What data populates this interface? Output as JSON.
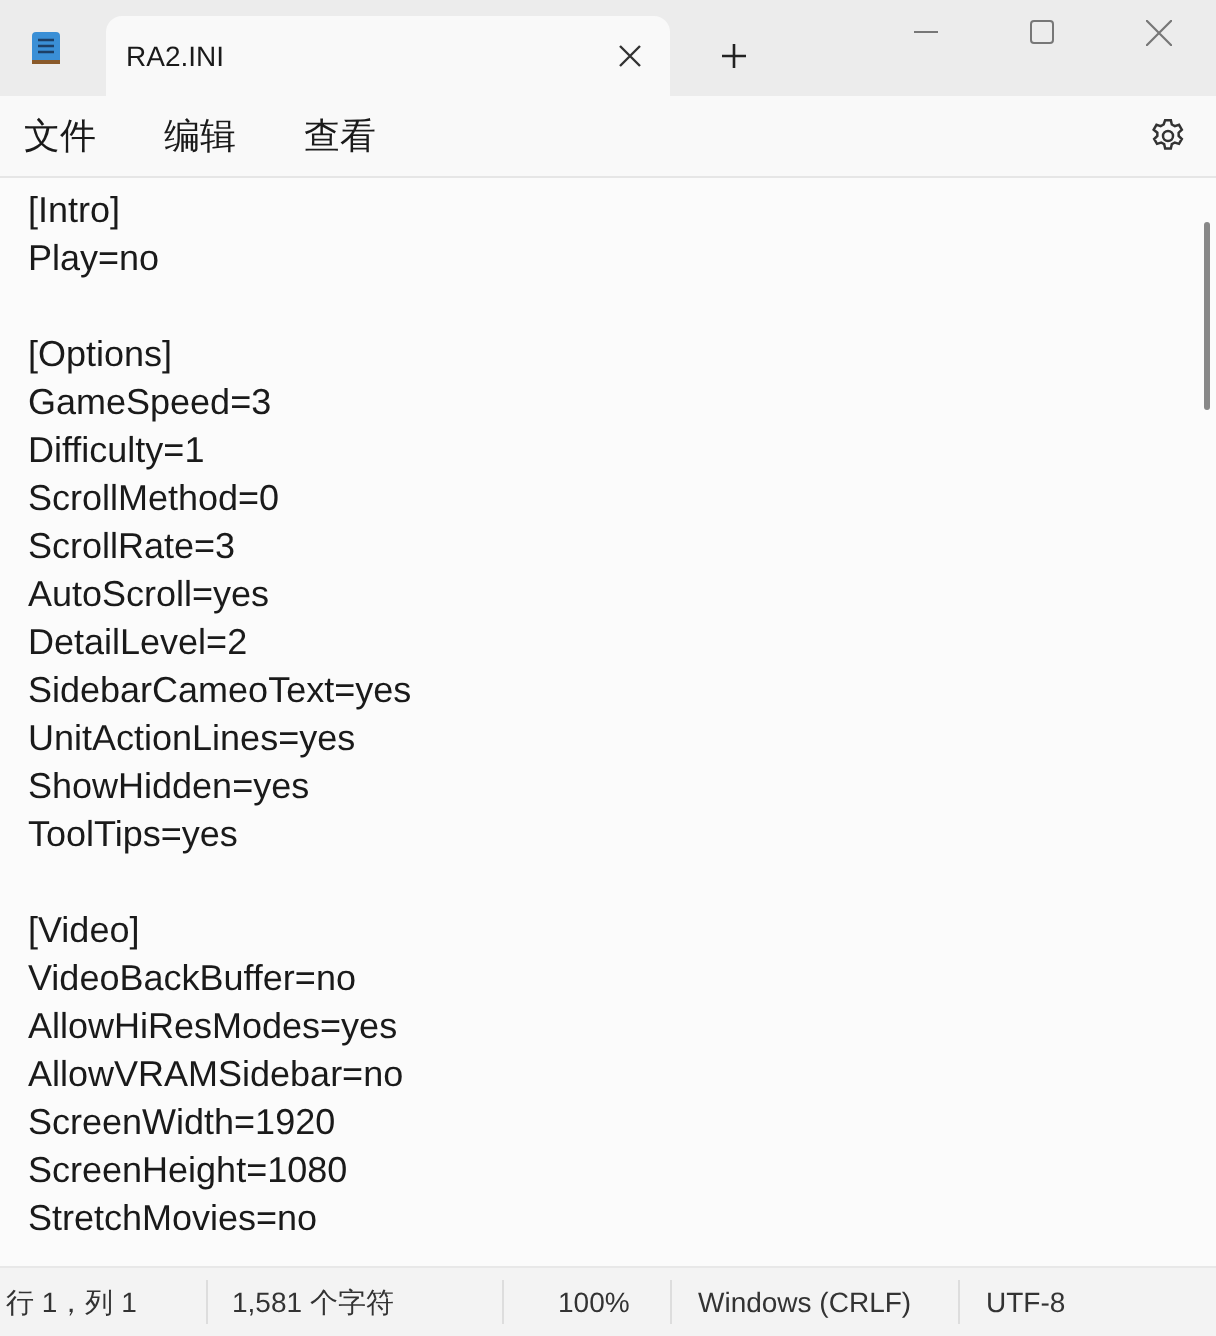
{
  "tabs": [
    {
      "label": "RA2.INI",
      "selected": true
    }
  ],
  "menu": [
    "文件",
    "编辑",
    "查看"
  ],
  "editor": {
    "blocks": [
      {
        "lines": [
          "[Intro]",
          "Play=no"
        ]
      },
      {
        "lines": [
          "[Options]",
          "GameSpeed=3",
          "Difficulty=1",
          "ScrollMethod=0",
          "ScrollRate=3",
          "AutoScroll=yes",
          "DetailLevel=2",
          "SidebarCameoText=yes",
          "UnitActionLines=yes",
          "ShowHidden=yes",
          "ToolTips=yes"
        ]
      },
      {
        "lines": [
          "[Video]",
          "VideoBackBuffer=no",
          "AllowHiResModes=yes",
          "AllowVRAMSidebar=no",
          "ScreenWidth=1920",
          "ScreenHeight=1080",
          "StretchMovies=no"
        ]
      }
    ]
  },
  "status_bar": [
    "行 1，列 1",
    "1,581 个字符",
    "100%",
    "Windows (CRLF)",
    "UTF-8"
  ]
}
